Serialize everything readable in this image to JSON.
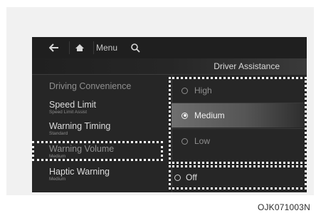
{
  "header": {
    "menu_label": "Menu",
    "title": "Driver Assistance"
  },
  "left_menu": {
    "items": [
      {
        "label": "Driving Convenience",
        "sub": ""
      },
      {
        "label": "Speed Limit",
        "sub": "Speed Limit Assist"
      },
      {
        "label": "Warning Timing",
        "sub": "Standard"
      },
      {
        "label": "Warning Volume",
        "sub": "Medium"
      },
      {
        "label": "Haptic Warning",
        "sub": "Medium"
      }
    ]
  },
  "options": {
    "items": [
      {
        "label": "High"
      },
      {
        "label": "Medium"
      },
      {
        "label": "Low"
      }
    ],
    "selected": "Medium",
    "off_label": "Off"
  },
  "icons": {
    "back": "back-arrow-icon",
    "home": "home-icon",
    "search": "search-icon"
  },
  "caption": "OJK071003N"
}
